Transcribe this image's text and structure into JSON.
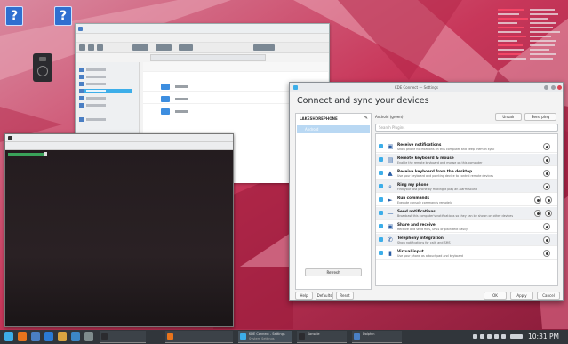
{
  "desktop": {
    "icons": [
      {
        "name": "unknown-file-icon-1",
        "glyph": "?"
      },
      {
        "name": "unknown-file-icon-2",
        "glyph": "?"
      }
    ]
  },
  "kde_connect": {
    "window_title": "KDE Connect — Settings",
    "heading": "Connect and sync your devices",
    "device_list_title": "LAKESHOREPHONE",
    "edit_icon": "edit-icon",
    "selected_device": "Android",
    "refresh_label": "Refresh",
    "device_name": "Android (green)",
    "unpair_label": "Unpair",
    "send_ping_label": "Send ping",
    "search_placeholder": "Search Plugins",
    "plugins": [
      {
        "name": "Receive notifications",
        "desc": "Show phone notifications on this computer and keep them in sync",
        "icon": "notification-icon",
        "configurable": true
      },
      {
        "name": "Remote keyboard & mouse",
        "desc": "Enable the remote keyboard and mouse on this computer",
        "icon": "keyboard-icon",
        "configurable": true
      },
      {
        "name": "Receive keyboard from the desktop",
        "desc": "Use your keyboard and pointing device to control remote devices",
        "icon": "mouse-icon",
        "configurable": true
      },
      {
        "name": "Ring my phone",
        "desc": "Find your lost phone by making it play an alarm sound",
        "icon": "search-icon",
        "configurable": true
      },
      {
        "name": "Run commands",
        "desc": "Execute console commands remotely",
        "icon": "run-icon",
        "configurable": true
      },
      {
        "name": "Send notifications",
        "desc": "Broadcast this computer's notifications so they can be shown on other devices",
        "icon": "bell-icon",
        "configurable": true
      },
      {
        "name": "Share and receive",
        "desc": "Receive and send files, URLs or plain text easily",
        "icon": "share-icon",
        "configurable": true
      },
      {
        "name": "Telephony integration",
        "desc": "Show notifications for calls and SMS",
        "icon": "phone-icon",
        "configurable": true
      },
      {
        "name": "Virtual input",
        "desc": "Use your phone as a touchpad and keyboard",
        "icon": "input-icon",
        "configurable": true
      }
    ],
    "footer": {
      "help_label": "Help",
      "defaults_label": "Defaults",
      "reset_label": "Reset",
      "ok_label": "OK",
      "apply_label": "Apply",
      "cancel_label": "Cancel"
    }
  },
  "taskbar": {
    "tasks": [
      {
        "title": "KDE Connect - Settings",
        "subtitle": "System Settings"
      },
      {
        "title": "Konsole",
        "subtitle": ""
      },
      {
        "title": "Dolphin",
        "subtitle": ""
      }
    ],
    "clock": "10:31 PM"
  },
  "colors": {
    "accent": "#3daee9",
    "taskbar": "#31363b",
    "wallpaper_primary": "#c8375a",
    "wallpaper_secondary": "#e37b95"
  }
}
